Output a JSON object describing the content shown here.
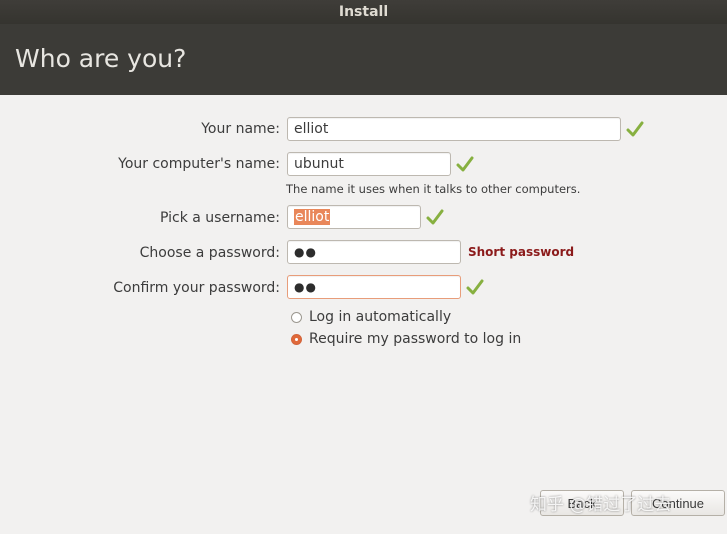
{
  "window": {
    "title": "Install"
  },
  "page": {
    "heading": "Who are you?"
  },
  "form": {
    "name": {
      "label": "Your name:",
      "value": "elliot"
    },
    "computer": {
      "label": "Your computer's name:",
      "value": "ubunut",
      "hint": "The name it uses when it talks to other computers."
    },
    "username": {
      "label": "Pick a username:",
      "value": "elliot"
    },
    "password": {
      "label": "Choose a password:",
      "value": "●●",
      "strength": "Short password"
    },
    "confirm": {
      "label": "Confirm your password:",
      "value": "●●"
    }
  },
  "login_options": {
    "auto": {
      "label": "Log in automatically",
      "selected": false
    },
    "require": {
      "label": "Require my password to log in",
      "selected": true
    }
  },
  "buttons": {
    "back": "Back",
    "continue": "Continue"
  },
  "watermark": "知乎 @错过了过去",
  "colors": {
    "check": "#87b040",
    "accent": "#e9875a",
    "warning": "#8b1a1a"
  }
}
